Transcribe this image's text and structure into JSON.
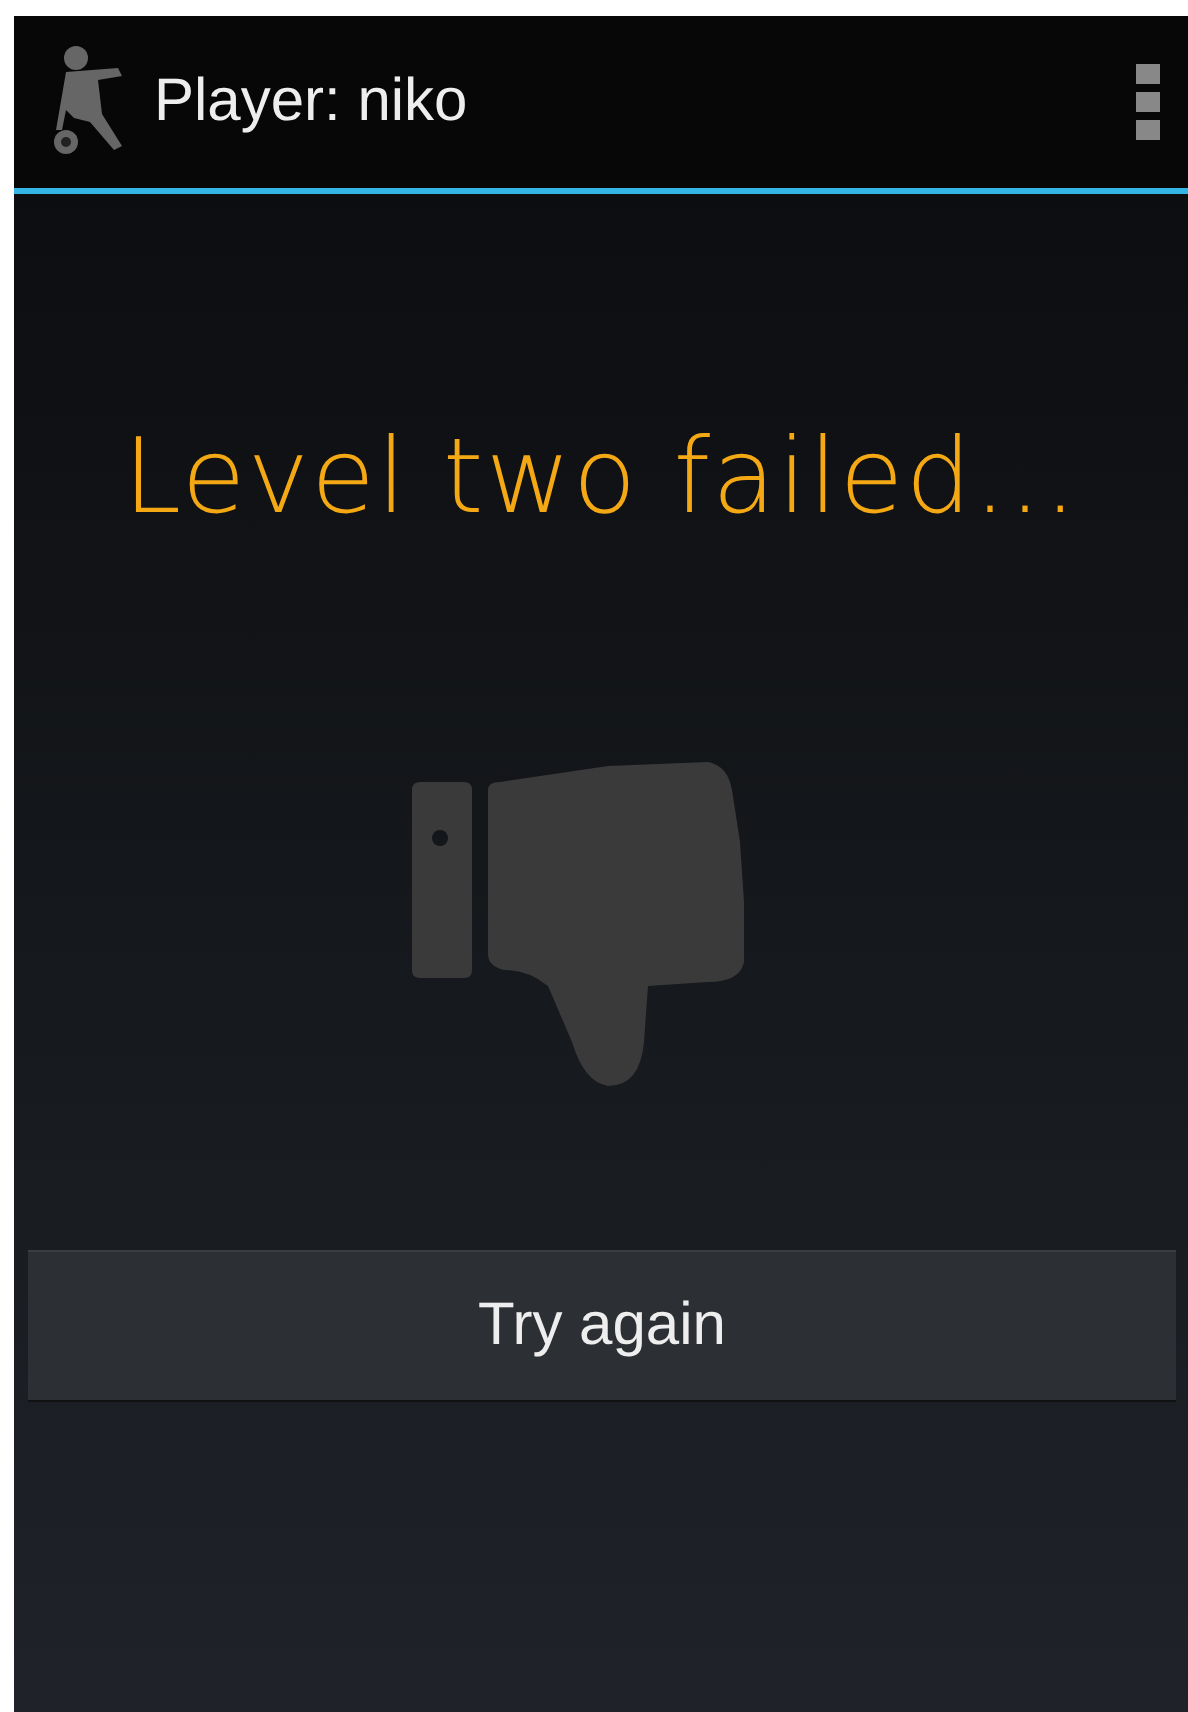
{
  "action_bar": {
    "title": "Player: niko"
  },
  "heading": "Level two failed...",
  "button": "Try again"
}
